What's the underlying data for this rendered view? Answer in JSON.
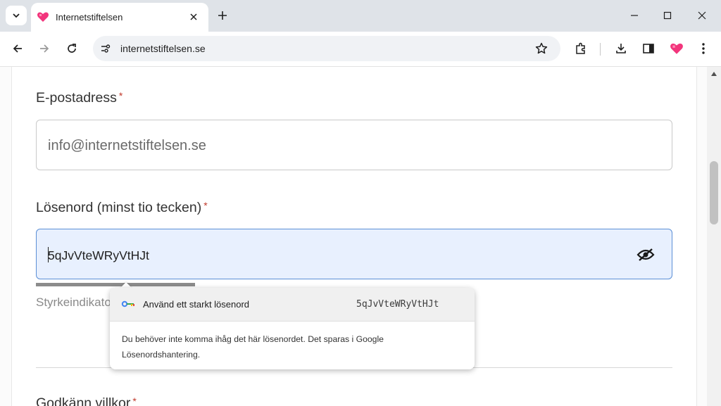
{
  "browser": {
    "tab": {
      "title": "Internetstiftelsen"
    },
    "address_bar": {
      "url": "internetstiftelsen.se"
    }
  },
  "form": {
    "email": {
      "label": "E-postadress",
      "required_mark": "*",
      "value": "info@internetstiftelsen.se"
    },
    "password": {
      "label": "Lösenord (minst tio tecken)",
      "required_mark": "*",
      "value": "5qJvVteWRyVtHJt"
    },
    "strength": {
      "hint": "Styrkeindikator"
    },
    "terms": {
      "label": "Godkänn villkor",
      "required_mark": "*"
    }
  },
  "password_popup": {
    "suggest_label": "Använd ett starkt lösenord",
    "suggested_password": "5qJvVteWRyVtHJt",
    "info": "Du behöver inte komma ihåg det här lösenordet. Det sparas i Google Lösenordshantering."
  },
  "colors": {
    "accent": "#e8f0fe",
    "required": "#c0392b",
    "favicon": "#f2357c"
  },
  "icons": [
    "chevron-down-icon",
    "heart-icon",
    "close-icon",
    "plus-icon",
    "minimize-icon",
    "maximize-icon",
    "back-icon",
    "forward-icon",
    "reload-icon",
    "site-info-icon",
    "star-icon",
    "extensions-icon",
    "download-icon",
    "side-panel-icon",
    "menu-icon",
    "eye-off-icon",
    "key-icon"
  ]
}
